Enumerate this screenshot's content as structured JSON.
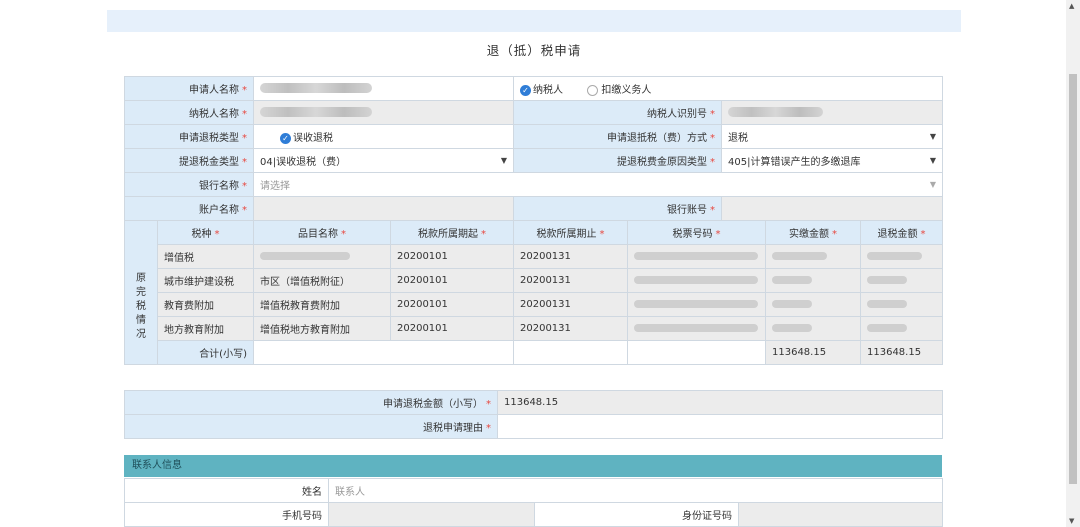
{
  "title": "退（抵）税申请",
  "applicant_label": "申请人名称",
  "taxpayer_label": "纳税人名称",
  "refund_type_label": "申请退税类型",
  "refund_type_value": "误收退税",
  "tax_amount_type_label": "提退税金类型",
  "tax_amount_type_value": "04|误收退税（费）",
  "bank_label": "银行名称",
  "bank_placeholder": "请选择",
  "account_name_label": "账户名称",
  "radio_taxpayer": "纳税人",
  "radio_withholder": "扣缴义务人",
  "taxpayer_id_label": "纳税人识别号",
  "refund_method_label": "申请退抵税（费）方式",
  "refund_method_value": "退税",
  "reason_type_label": "提退税费金原因类型",
  "reason_type_value": "405|计算错误产生的多缴退库",
  "bank_account_label": "银行账号",
  "side_label": [
    "原",
    "完",
    "税",
    "情",
    "况"
  ],
  "table_headers": [
    "税种",
    "品目名称",
    "税款所属期起",
    "税款所属期止",
    "税票号码",
    "实缴金额",
    "退税金额"
  ],
  "rows": [
    {
      "tax": "增值税",
      "item": "",
      "start": "20200101",
      "end": "20200131"
    },
    {
      "tax": "城市维护建设税",
      "item": "市区（增值税附征）",
      "start": "20200101",
      "end": "20200131"
    },
    {
      "tax": "教育费附加",
      "item": "增值税教育费附加",
      "start": "20200101",
      "end": "20200131"
    },
    {
      "tax": "地方教育附加",
      "item": "增值税地方教育附加",
      "start": "20200101",
      "end": "20200131"
    }
  ],
  "total_label": "合计(小写)",
  "total_paid": "113648.15",
  "total_refund": "113648.15",
  "apply_amount_label": "申请退税金额（小写）",
  "apply_amount_value": "113648.15",
  "apply_reason_label": "退税申请理由",
  "contact_section": "联系人信息",
  "name_label": "姓名",
  "name_placeholder": "联系人",
  "phone_label": "手机号码",
  "idcard_label": "身份证号码",
  "required_mark": "*",
  "icons": {
    "check": "check-icon",
    "arrow": "dropdown-arrow-icon"
  }
}
